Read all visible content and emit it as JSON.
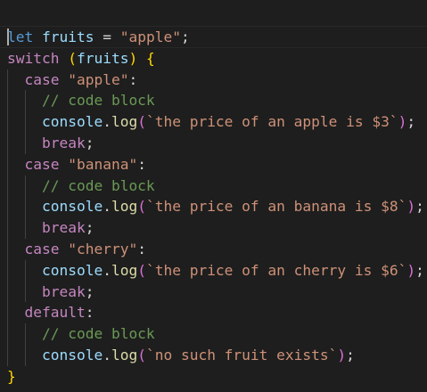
{
  "editor": {
    "theme": {
      "background": "#1e1e1e",
      "keyword": "#569cd6",
      "control": "#c586c0",
      "variable": "#9cdcfe",
      "string": "#ce9178",
      "function": "#dcdcaa",
      "comment": "#6a9955",
      "bracket_level1": "#ffd700",
      "bracket_level2": "#da70d6",
      "punctuation": "#d4d4d4"
    },
    "cursor_line": 1,
    "lines": [
      {
        "indent": 0,
        "tokens": [
          {
            "t": "kw",
            "v": "let"
          },
          {
            "t": "op",
            "v": " "
          },
          {
            "t": "var",
            "v": "fruits"
          },
          {
            "t": "op",
            "v": " = "
          },
          {
            "t": "str",
            "v": "\"apple\""
          },
          {
            "t": "pun",
            "v": ";"
          }
        ]
      },
      {
        "indent": 0,
        "tokens": [
          {
            "t": "ctl",
            "v": "switch"
          },
          {
            "t": "op",
            "v": " "
          },
          {
            "t": "br1",
            "v": "("
          },
          {
            "t": "var",
            "v": "fruits"
          },
          {
            "t": "br1",
            "v": ")"
          },
          {
            "t": "op",
            "v": " "
          },
          {
            "t": "br1",
            "v": "{"
          }
        ]
      },
      {
        "indent": 1,
        "tokens": [
          {
            "t": "ctl",
            "v": "case"
          },
          {
            "t": "op",
            "v": " "
          },
          {
            "t": "str",
            "v": "\"apple\""
          },
          {
            "t": "pun",
            "v": ":"
          }
        ]
      },
      {
        "indent": 2,
        "tokens": [
          {
            "t": "cmt",
            "v": "// code block"
          }
        ]
      },
      {
        "indent": 2,
        "tokens": [
          {
            "t": "var",
            "v": "console"
          },
          {
            "t": "pun",
            "v": "."
          },
          {
            "t": "fn",
            "v": "log"
          },
          {
            "t": "br2",
            "v": "("
          },
          {
            "t": "str",
            "v": "`the price of an apple is $3`"
          },
          {
            "t": "br2",
            "v": ")"
          },
          {
            "t": "pun",
            "v": ";"
          }
        ]
      },
      {
        "indent": 2,
        "tokens": [
          {
            "t": "ctl",
            "v": "break"
          },
          {
            "t": "pun",
            "v": ";"
          }
        ]
      },
      {
        "indent": 1,
        "tokens": [
          {
            "t": "ctl",
            "v": "case"
          },
          {
            "t": "op",
            "v": " "
          },
          {
            "t": "str",
            "v": "\"banana\""
          },
          {
            "t": "pun",
            "v": ":"
          }
        ]
      },
      {
        "indent": 2,
        "tokens": [
          {
            "t": "cmt",
            "v": "// code block"
          }
        ]
      },
      {
        "indent": 2,
        "tokens": [
          {
            "t": "var",
            "v": "console"
          },
          {
            "t": "pun",
            "v": "."
          },
          {
            "t": "fn",
            "v": "log"
          },
          {
            "t": "br2",
            "v": "("
          },
          {
            "t": "str",
            "v": "`the price of an banana is $8`"
          },
          {
            "t": "br2",
            "v": ")"
          },
          {
            "t": "pun",
            "v": ";"
          }
        ]
      },
      {
        "indent": 2,
        "tokens": [
          {
            "t": "ctl",
            "v": "break"
          },
          {
            "t": "pun",
            "v": ";"
          }
        ]
      },
      {
        "indent": 1,
        "tokens": [
          {
            "t": "ctl",
            "v": "case"
          },
          {
            "t": "op",
            "v": " "
          },
          {
            "t": "str",
            "v": "\"cherry\""
          },
          {
            "t": "pun",
            "v": ":"
          }
        ]
      },
      {
        "indent": 2,
        "tokens": [
          {
            "t": "var",
            "v": "console"
          },
          {
            "t": "pun",
            "v": "."
          },
          {
            "t": "fn",
            "v": "log"
          },
          {
            "t": "br2",
            "v": "("
          },
          {
            "t": "str",
            "v": "`the price of an cherry is $6`"
          },
          {
            "t": "br2",
            "v": ")"
          },
          {
            "t": "pun",
            "v": ";"
          }
        ]
      },
      {
        "indent": 2,
        "tokens": [
          {
            "t": "ctl",
            "v": "break"
          },
          {
            "t": "pun",
            "v": ";"
          }
        ]
      },
      {
        "indent": 1,
        "tokens": [
          {
            "t": "ctl",
            "v": "default"
          },
          {
            "t": "pun",
            "v": ":"
          }
        ]
      },
      {
        "indent": 2,
        "tokens": [
          {
            "t": "cmt",
            "v": "// code block"
          }
        ]
      },
      {
        "indent": 2,
        "tokens": [
          {
            "t": "var",
            "v": "console"
          },
          {
            "t": "pun",
            "v": "."
          },
          {
            "t": "fn",
            "v": "log"
          },
          {
            "t": "br2",
            "v": "("
          },
          {
            "t": "str",
            "v": "`no such fruit exists`"
          },
          {
            "t": "br2",
            "v": ")"
          },
          {
            "t": "pun",
            "v": ";"
          }
        ]
      },
      {
        "indent": 0,
        "tokens": [
          {
            "t": "br1",
            "v": "}"
          }
        ]
      }
    ]
  }
}
